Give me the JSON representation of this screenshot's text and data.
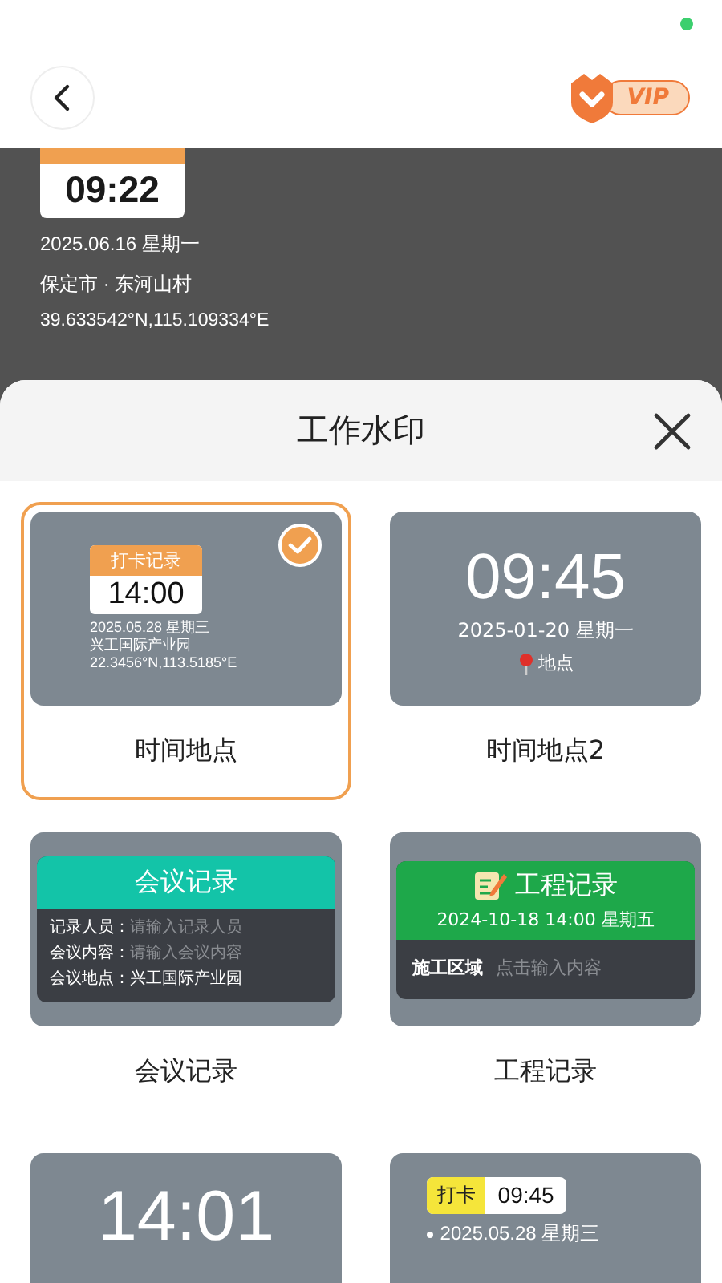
{
  "top_bar": {
    "vip_label": "VIP"
  },
  "camera_preview": {
    "watermark": {
      "time": "09:22",
      "date": "2025.06.16 星期一",
      "place": "保定市 · 东河山村",
      "coords": "39.633542°N,115.109334°E"
    }
  },
  "sheet": {
    "title": "工作水印"
  },
  "templates": [
    {
      "kind": "punch",
      "label": "时间地点",
      "selected": true,
      "badge": "打卡记录",
      "time": "14:00",
      "lines": [
        "2025.05.28  星期三",
        "兴工国际产业园",
        "22.3456°N,113.5185°E"
      ]
    },
    {
      "kind": "clock",
      "label": "时间地点2",
      "selected": false,
      "time": "09:45",
      "date": "2025-01-20   星期一",
      "place": "地点"
    },
    {
      "kind": "meeting",
      "label": "会议记录",
      "selected": false,
      "title": "会议记录",
      "fields": [
        {
          "name": "记录人员：",
          "placeholder": "请输入记录人员"
        },
        {
          "name": "会议内容：",
          "placeholder": "请输入会议内容"
        },
        {
          "name": "会议地点：",
          "value": "兴工国际产业园"
        }
      ]
    },
    {
      "kind": "project",
      "label": "工程记录",
      "selected": false,
      "title": "工程记录",
      "datetime": "2024-10-18 14:00 星期五",
      "field": "施工区域",
      "placeholder": "点击输入内容"
    },
    {
      "kind": "bigclock",
      "selected": false,
      "time": "14:01"
    },
    {
      "kind": "punch2",
      "selected": false,
      "badge": "打卡",
      "time": "09:45",
      "date": "2025.05.28  星期三"
    }
  ]
}
